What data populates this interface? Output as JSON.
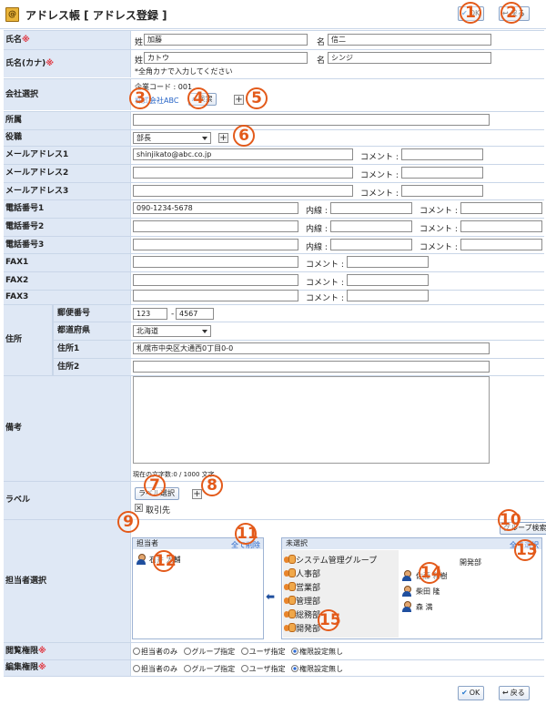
{
  "window": {
    "title": "アドレス帳 [ アドレス登録 ]",
    "app_icon": "address-book-icon"
  },
  "toolbar": {
    "ok_label": "OK",
    "back_label": "戻る"
  },
  "markers": [
    "1",
    "2",
    "3",
    "4",
    "5",
    "6",
    "7",
    "8",
    "9",
    "10",
    "11",
    "12",
    "13",
    "14",
    "15"
  ],
  "form": {
    "name": {
      "label": "氏名",
      "required": "※",
      "sei_label": "姓",
      "sei_value": "加藤",
      "mei_label": "名",
      "mei_value": "信二"
    },
    "kana": {
      "label": "氏名(カナ)",
      "required": "※",
      "sei_label": "姓",
      "sei_value": "カトウ",
      "mei_label": "名",
      "mei_value": "シンジ",
      "hint": "*全角カナで入力してください"
    },
    "company": {
      "label": "会社選択",
      "code_label": "企業コード : 001",
      "company_name": "株式会社ABC",
      "search_button": "検索"
    },
    "department": {
      "label": "所属",
      "value": ""
    },
    "position": {
      "label": "役職",
      "value": "部長"
    },
    "emails": [
      {
        "label": "メールアドレス1",
        "value": "shinjikato@abc.co.jp",
        "comment_label": "コメント :",
        "comment": ""
      },
      {
        "label": "メールアドレス2",
        "value": "",
        "comment_label": "コメント :",
        "comment": ""
      },
      {
        "label": "メールアドレス3",
        "value": "",
        "comment_label": "コメント :",
        "comment": ""
      }
    ],
    "phones": [
      {
        "label": "電話番号1",
        "value": "090-1234-5678",
        "ext_label": "内線 :",
        "ext": "",
        "comment_label": "コメント :",
        "comment": ""
      },
      {
        "label": "電話番号2",
        "value": "",
        "ext_label": "内線 :",
        "ext": "",
        "comment_label": "コメント :",
        "comment": ""
      },
      {
        "label": "電話番号3",
        "value": "",
        "ext_label": "内線 :",
        "ext": "",
        "comment_label": "コメント :",
        "comment": ""
      }
    ],
    "faxes": [
      {
        "label": "FAX1",
        "value": "",
        "comment_label": "コメント :",
        "comment": ""
      },
      {
        "label": "FAX2",
        "value": "",
        "comment_label": "コメント :",
        "comment": ""
      },
      {
        "label": "FAX3",
        "value": "",
        "comment_label": "コメント :",
        "comment": ""
      }
    ],
    "address": {
      "label": "住所",
      "postal_label": "郵便番号",
      "postal1": "123",
      "postal_sep": "-",
      "postal2": "4567",
      "pref_label": "都道府県",
      "pref_value": "北海道",
      "addr1_label": "住所1",
      "addr1_value": "札幌市中央区大通西0丁目0-0",
      "addr2_label": "住所2",
      "addr2_value": ""
    },
    "notes": {
      "label": "備考",
      "value": "",
      "counter": "現在の文字数:0 / 1000 文字"
    },
    "label": {
      "label": "ラベル",
      "select_button": "ラベル選択",
      "tag": "取引先",
      "tag_remove": "×"
    },
    "staff": {
      "label": "担当者選択",
      "search_button": "グループ検索",
      "left_head": "担当者",
      "left_action": "全て削除",
      "left_items": [
        "石井 大輔"
      ],
      "right_head": "未選択",
      "right_action": "全て選択",
      "groups": [
        "システム管理グループ",
        "人事部",
        "営業部",
        "管理部",
        "総務部",
        "開発部"
      ],
      "selected_group": "開発部",
      "members": [
        "佐藤 和樹",
        "柴田 隆",
        "森 満"
      ]
    },
    "view_perm": {
      "label": "閲覧権限",
      "required": "※",
      "options": [
        "担当者のみ",
        "グループ指定",
        "ユーザ指定",
        "権限設定無し"
      ],
      "selected": "権限設定無し"
    },
    "edit_perm": {
      "label": "編集権限",
      "required": "※",
      "options": [
        "担当者のみ",
        "グループ指定",
        "ユーザ指定",
        "権限設定無し"
      ],
      "selected": "権限設定無し"
    }
  },
  "footer": {
    "ok_label": "OK",
    "back_label": "戻る"
  }
}
